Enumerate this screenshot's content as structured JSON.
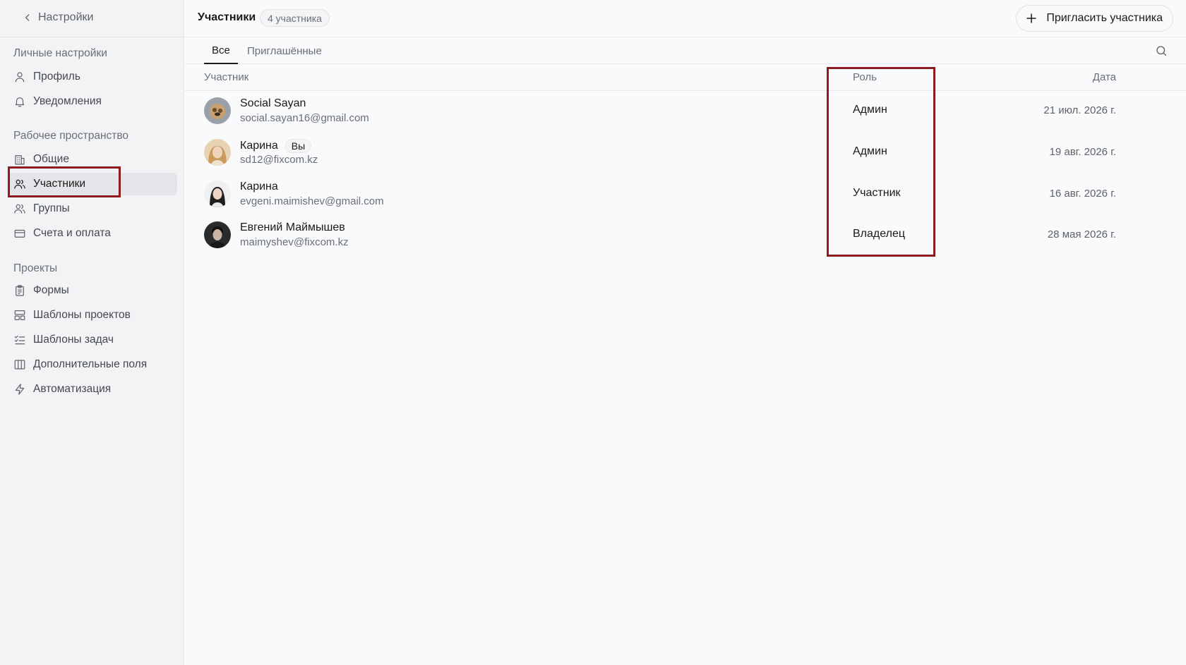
{
  "sidebar": {
    "back_label": "Настройки",
    "sections": [
      {
        "title": "Личные настройки",
        "items": [
          {
            "label": "Профиль",
            "icon": "user-icon"
          },
          {
            "label": "Уведомления",
            "icon": "bell-icon"
          }
        ]
      },
      {
        "title": "Рабочее пространство",
        "items": [
          {
            "label": "Общие",
            "icon": "building-icon"
          },
          {
            "label": "Участники",
            "icon": "users-icon",
            "active": true
          },
          {
            "label": "Группы",
            "icon": "users-group-icon"
          },
          {
            "label": "Счета и оплата",
            "icon": "credit-card-icon"
          }
        ]
      },
      {
        "title": "Проекты",
        "items": [
          {
            "label": "Формы",
            "icon": "clipboard-icon"
          },
          {
            "label": "Шаблоны проектов",
            "icon": "layout-template-icon"
          },
          {
            "label": "Шаблоны задач",
            "icon": "list-checks-icon"
          },
          {
            "label": "Дополнительные поля",
            "icon": "columns-icon"
          },
          {
            "label": "Автоматизация",
            "icon": "zap-icon"
          }
        ]
      }
    ]
  },
  "header": {
    "title": "Участники",
    "count_badge": "4 участника",
    "invite_label": "Пригласить участника"
  },
  "tabs": [
    {
      "label": "Все",
      "active": true
    },
    {
      "label": "Приглашённые",
      "active": false
    }
  ],
  "table": {
    "columns": {
      "member": "Участник",
      "role": "Роль",
      "date": "Дата"
    },
    "rows": [
      {
        "name": "Social Sayan",
        "email": "social.sayan16@gmail.com",
        "role": "Админ",
        "date": "21 июл. 2026 г.",
        "you": ""
      },
      {
        "name": "Карина",
        "email": "sd12@fixcom.kz",
        "role": "Админ",
        "date": "19 авг. 2026 г.",
        "you": "Вы"
      },
      {
        "name": "Карина",
        "email": "evgeni.maimishev@gmail.com",
        "role": "Участник",
        "date": "16 авг. 2026 г.",
        "you": ""
      },
      {
        "name": "Евгений Маймышев",
        "email": "maimyshev@fixcom.kz",
        "role": "Владелец",
        "date": "28 мая 2026 г.",
        "you": ""
      }
    ]
  },
  "colors": {
    "highlight": "#8e1b1f",
    "sidebar_bg": "#f2f3f5",
    "active_item_bg": "#e4e5e8"
  }
}
